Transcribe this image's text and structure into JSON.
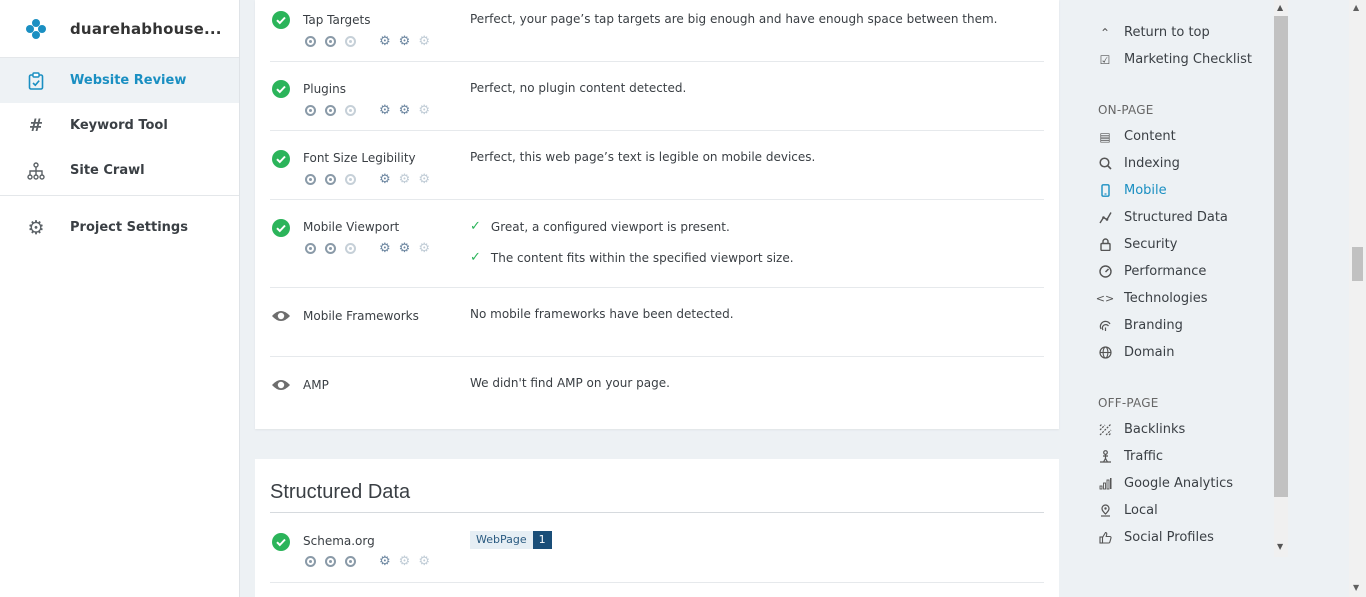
{
  "sidebar": {
    "brand": "duarehabhouse...",
    "items": [
      {
        "label": "Website Review",
        "icon": "clipboard-check-icon"
      },
      {
        "label": "Keyword Tool",
        "icon": "hash-icon"
      },
      {
        "label": "Site Crawl",
        "icon": "sitemap-icon"
      },
      {
        "label": "Project Settings",
        "icon": "gear-icon"
      }
    ]
  },
  "mobile": {
    "rows": [
      {
        "label": "Tap Targets",
        "desc": "Perfect, your page’s tap targets are big enough and have enough space between them.",
        "status": "pass"
      },
      {
        "label": "Plugins",
        "desc": "Perfect, no plugin content detected.",
        "status": "pass"
      },
      {
        "label": "Font Size Legibility",
        "desc": "Perfect, this web page’s text is legible on mobile devices.",
        "status": "pass"
      },
      {
        "label": "Mobile Viewport",
        "desc1": "Great, a configured viewport is present.",
        "desc2": "The content fits within the specified viewport size.",
        "status": "pass"
      },
      {
        "label": "Mobile Frameworks",
        "desc": "No mobile frameworks have been detected.",
        "status": "info"
      },
      {
        "label": "AMP",
        "desc": "We didn't find AMP on your page.",
        "status": "info"
      }
    ]
  },
  "structured": {
    "title": "Structured Data",
    "rows": [
      {
        "label": "Schema.org",
        "tag": "WebPage",
        "count": "1",
        "status": "pass"
      }
    ]
  },
  "rightnav": {
    "top": [
      {
        "label": "Return to top",
        "icon": "chevron-up-icon"
      },
      {
        "label": "Marketing Checklist",
        "icon": "checkbox-icon"
      }
    ],
    "onpage_heading": "ON-PAGE",
    "onpage": [
      {
        "label": "Content",
        "icon": "document-icon"
      },
      {
        "label": "Indexing",
        "icon": "search-icon"
      },
      {
        "label": "Mobile",
        "icon": "mobile-icon",
        "active": true
      },
      {
        "label": "Structured Data",
        "icon": "graph-icon"
      },
      {
        "label": "Security",
        "icon": "lock-icon"
      },
      {
        "label": "Performance",
        "icon": "gauge-icon"
      },
      {
        "label": "Technologies",
        "icon": "code-icon"
      },
      {
        "label": "Branding",
        "icon": "fingerprint-icon"
      },
      {
        "label": "Domain",
        "icon": "globe-icon"
      }
    ],
    "offpage_heading": "OFF-PAGE",
    "offpage": [
      {
        "label": "Backlinks",
        "icon": "link-icon"
      },
      {
        "label": "Traffic",
        "icon": "traffic-icon"
      },
      {
        "label": "Google Analytics",
        "icon": "bar-chart-icon"
      },
      {
        "label": "Local",
        "icon": "pin-icon"
      },
      {
        "label": "Social Profiles",
        "icon": "thumbs-up-icon"
      }
    ]
  },
  "colors": {
    "accent": "#1a8fc2",
    "pass": "#2bb45a",
    "info": "#6d6d6d"
  }
}
